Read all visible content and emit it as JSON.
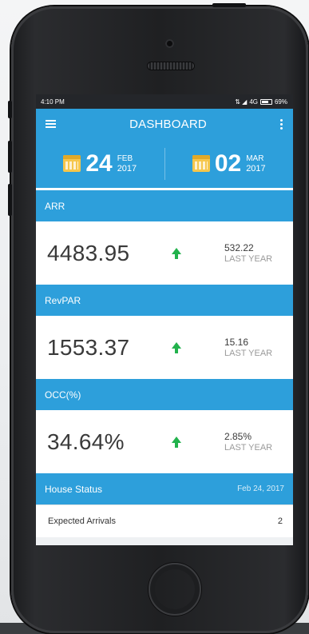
{
  "status_bar": {
    "time": "4:10 PM",
    "network": "4G",
    "battery": "69%"
  },
  "app_bar": {
    "title": "DASHBOARD"
  },
  "date_range": {
    "start": {
      "day": "24",
      "month": "FEB",
      "year": "2017"
    },
    "end": {
      "day": "02",
      "month": "MAR",
      "year": "2017"
    }
  },
  "metrics": [
    {
      "name": "ARR",
      "value": "4483.95",
      "last_year_value": "532.22",
      "last_year_label": "LAST YEAR"
    },
    {
      "name": "RevPAR",
      "value": "1553.37",
      "last_year_value": "15.16",
      "last_year_label": "LAST YEAR"
    },
    {
      "name": "OCC(%)",
      "value": "34.64%",
      "last_year_value": "2.85%",
      "last_year_label": "LAST YEAR"
    }
  ],
  "house_status": {
    "title": "House Status",
    "date": "Feb 24, 2017",
    "rows": [
      {
        "label": "Expected Arrivals",
        "count": "2"
      }
    ]
  },
  "colors": {
    "primary": "#2d9fdb",
    "trend_up": "#22b24c",
    "calendar_icon": "#f6c64b"
  }
}
